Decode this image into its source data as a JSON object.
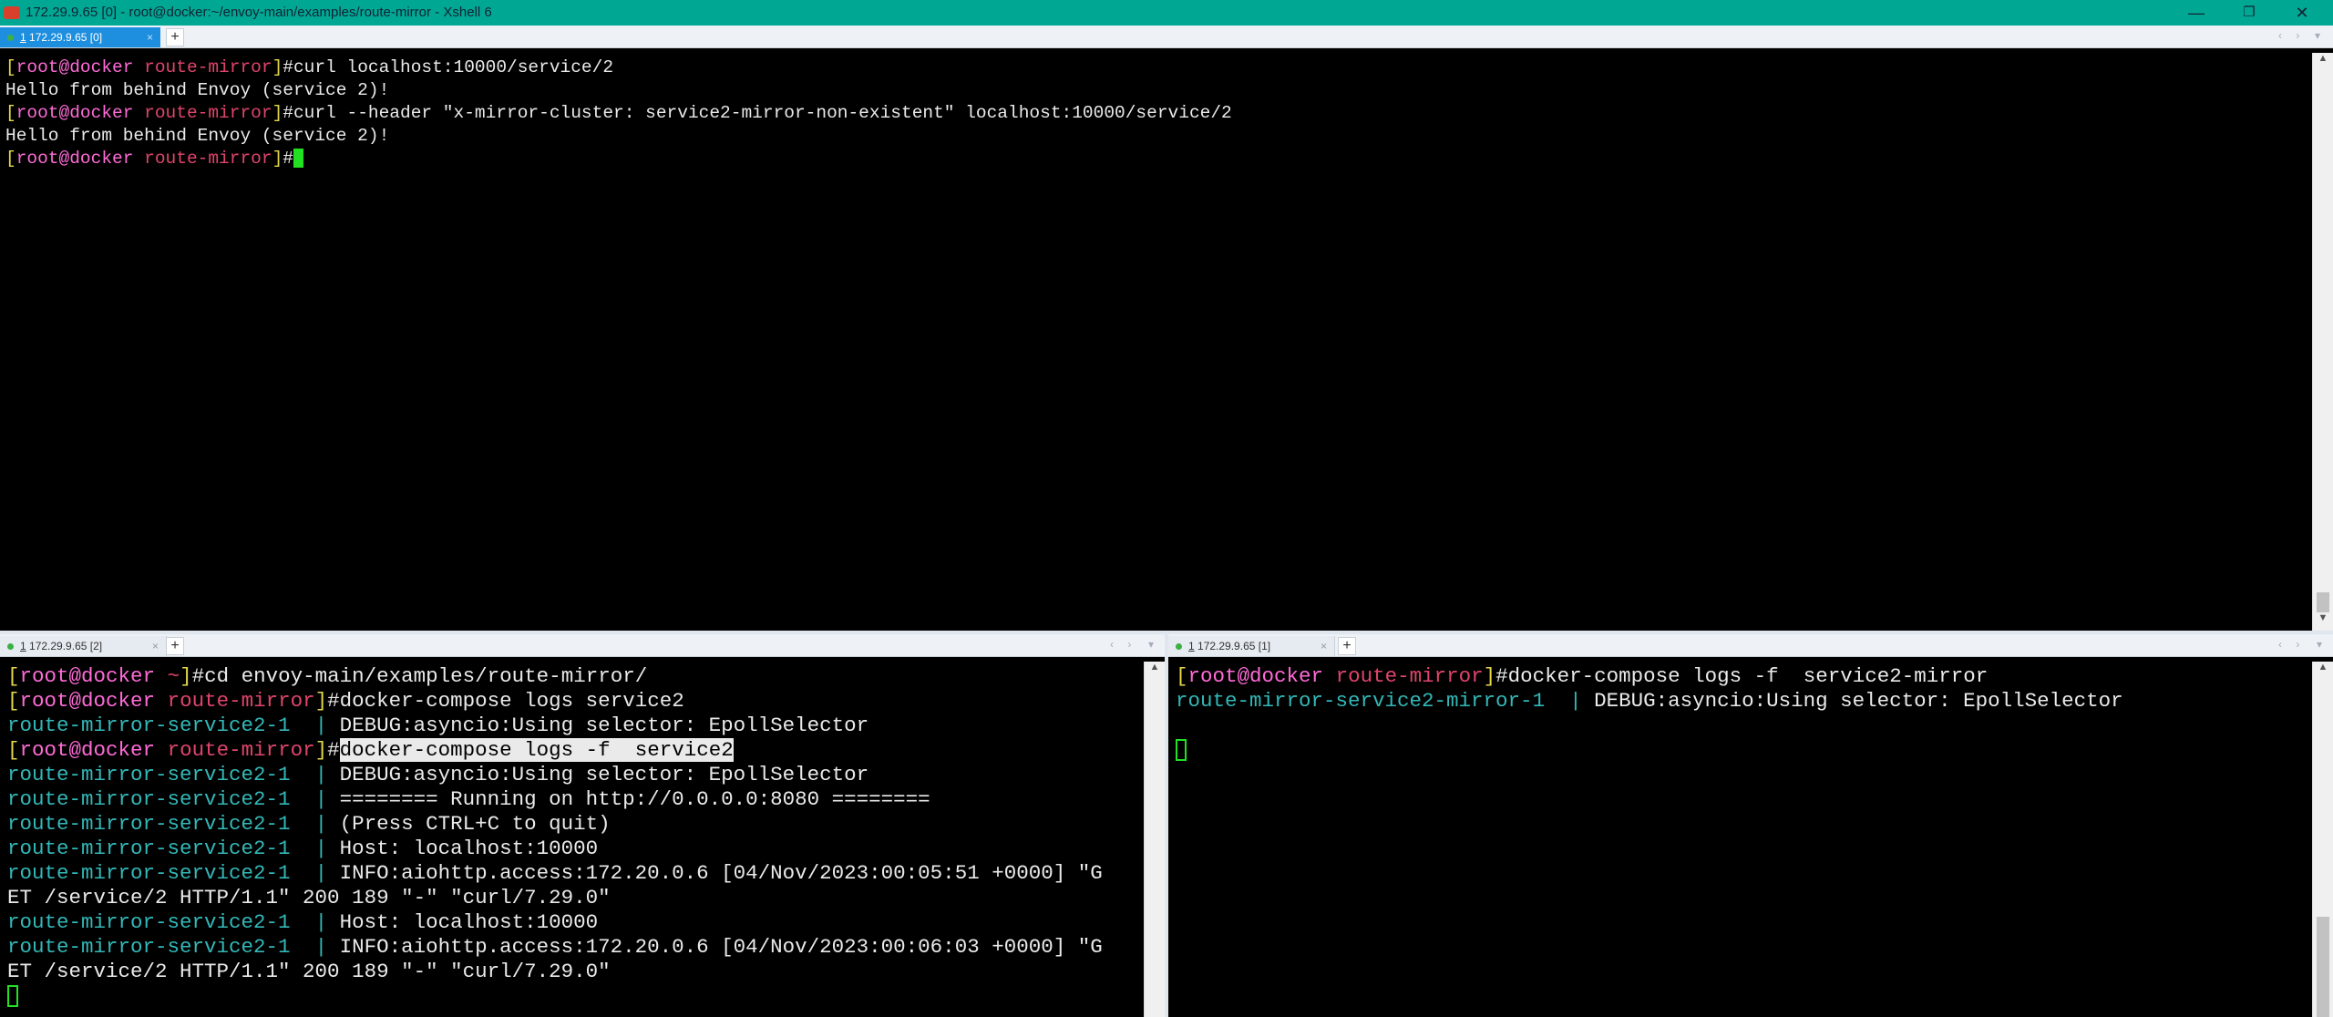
{
  "window": {
    "title": "172.29.9.65 [0] - root@docker:~/envoy-main/examples/route-mirror - Xshell 6",
    "minimize": "—",
    "maximize": "❐",
    "close": "✕",
    "icon": "xshell-app-icon"
  },
  "top_session": {
    "tab_label": "1 172.29.9.65 [0]",
    "tab_num": "1",
    "tab_host": " 172.29.9.65 [0]",
    "add_label": "+",
    "lines": [
      {
        "user": "root",
        "host": "docker",
        "path": "route-mirror",
        "cmd": "curl localhost:10000/service/2"
      },
      {
        "text": "Hello from behind Envoy (service 2)!"
      },
      {
        "user": "root",
        "host": "docker",
        "path": "route-mirror",
        "cmd": "curl --header \"x-mirror-cluster: service2-mirror-non-existent\" localhost:10000/service/2"
      },
      {
        "text": "Hello from behind Envoy (service 2)!"
      },
      {
        "user": "root",
        "host": "docker",
        "path": "route-mirror",
        "cmd": ""
      }
    ]
  },
  "left_session": {
    "tab_num": "1",
    "tab_host": " 172.29.9.65 [2]",
    "add_label": "+",
    "prompt1": {
      "user": "root",
      "at": "@",
      "host": "docker",
      "path": "~",
      "cmd": "cd envoy-main/examples/route-mirror/"
    },
    "prompt2": {
      "user": "root",
      "host": "docker",
      "path": "route-mirror",
      "cmd": "docker-compose logs service2"
    },
    "log1": {
      "svc": "route-mirror-service2-1",
      "sep": "  | ",
      "msg": "DEBUG:asyncio:Using selector: EpollSelector"
    },
    "prompt3": {
      "user": "root",
      "host": "docker",
      "path": "route-mirror",
      "cmd": "docker-compose logs -f  service2"
    },
    "logs": [
      {
        "svc": "route-mirror-service2-1",
        "sep": "  | ",
        "msg": "DEBUG:asyncio:Using selector: EpollSelector"
      },
      {
        "svc": "route-mirror-service2-1",
        "sep": "  | ",
        "msg": "======== Running on http://0.0.0.0:8080 ========"
      },
      {
        "svc": "route-mirror-service2-1",
        "sep": "  | ",
        "msg": "(Press CTRL+C to quit)"
      },
      {
        "svc": "route-mirror-service2-1",
        "sep": "  | ",
        "msg": "Host: localhost:10000"
      },
      {
        "svc": "route-mirror-service2-1",
        "sep": "  | ",
        "msg": "INFO:aiohttp.access:172.20.0.6 [04/Nov/2023:00:05:51 +0000] \"G"
      },
      {
        "wrap": "ET /service/2 HTTP/1.1\" 200 189 \"-\" \"curl/7.29.0\""
      },
      {
        "svc": "route-mirror-service2-1",
        "sep": "  | ",
        "msg": "Host: localhost:10000"
      },
      {
        "svc": "route-mirror-service2-1",
        "sep": "  | ",
        "msg": "INFO:aiohttp.access:172.20.0.6 [04/Nov/2023:00:06:03 +0000] \"G"
      },
      {
        "wrap": "ET /service/2 HTTP/1.1\" 200 189 \"-\" \"curl/7.29.0\""
      }
    ]
  },
  "right_session": {
    "tab_num": "1",
    "tab_host": " 172.29.9.65 [1]",
    "add_label": "+",
    "prompt": {
      "user": "root",
      "host": "docker",
      "path": "route-mirror",
      "cmd": "docker-compose logs -f  service2-mirror"
    },
    "log": {
      "svc": "route-mirror-service2-mirror-1",
      "sep": "  | ",
      "msg": "DEBUG:asyncio:Using selector: EpollSelector"
    }
  },
  "glyphs": {
    "open": "[",
    "close": "]",
    "at": "@",
    "hash": "#",
    "space": " ",
    "x": "×",
    "nav": "‹ ›",
    "drop": "▾",
    "up": "▲",
    "down": "▼"
  },
  "colors": {
    "titlebar": "#00a894",
    "active_tab": "#1e8fdf",
    "prompt_user": "#ff6bd7",
    "prompt_path": "#e0456b",
    "service_name": "#33b8b8",
    "cursor": "#22e022"
  }
}
